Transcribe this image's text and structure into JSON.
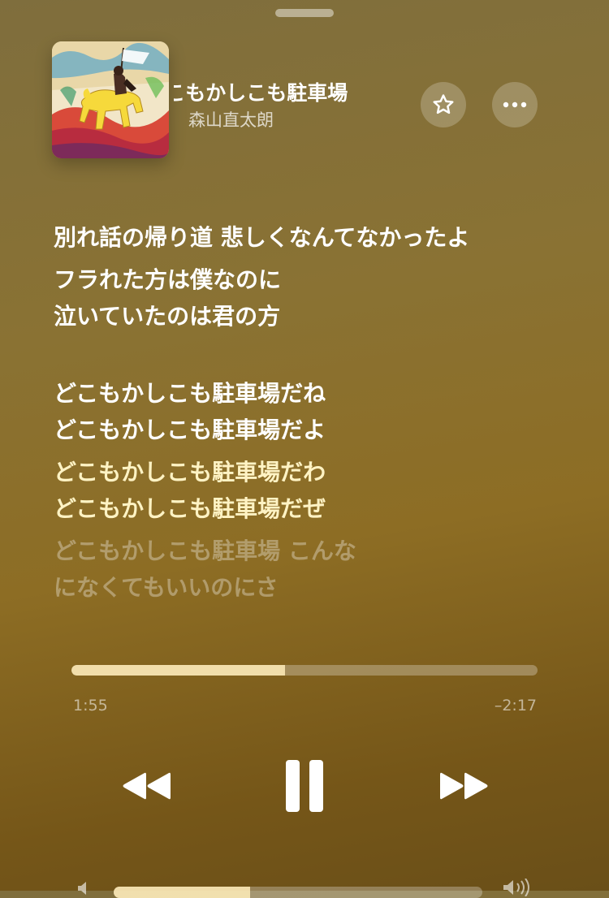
{
  "now_playing": {
    "title_visible": "車場　　　どこもかしこも駐車場",
    "artist": "森山直太朗"
  },
  "actions": {
    "favorite_icon": "star-icon",
    "more_icon": "ellipsis-icon"
  },
  "lyrics": {
    "lines": [
      "別れ話の帰り道 悲しくなんてなかったよ",
      "フラれた方は僕なのに",
      "泣いていたのは君の方",
      "どこもかしこも駐車場だね",
      "どこもかしこも駐車場だよ",
      "どこもかしこも駐車場だわ",
      "どこもかしこも駐車場だぜ",
      "どこもかしこも駐車場 こんな",
      "になくてもいいのにさ"
    ],
    "current_index": 6
  },
  "playback": {
    "elapsed": "1:55",
    "remaining": "–2:17",
    "progress": 0.459
  },
  "controls": {
    "previous_icon": "rewind-icon",
    "play_pause_icon": "pause-icon",
    "next_icon": "fast-forward-icon"
  },
  "volume": {
    "level": 0.37,
    "low_icon": "speaker-low-icon",
    "high_icon": "speaker-high-icon"
  },
  "colors": {
    "background_top": "#7f6e3d",
    "background_bottom": "#6a4f18",
    "current_lyric": "#fff3c4",
    "progress_fill": "#ffecb9"
  }
}
